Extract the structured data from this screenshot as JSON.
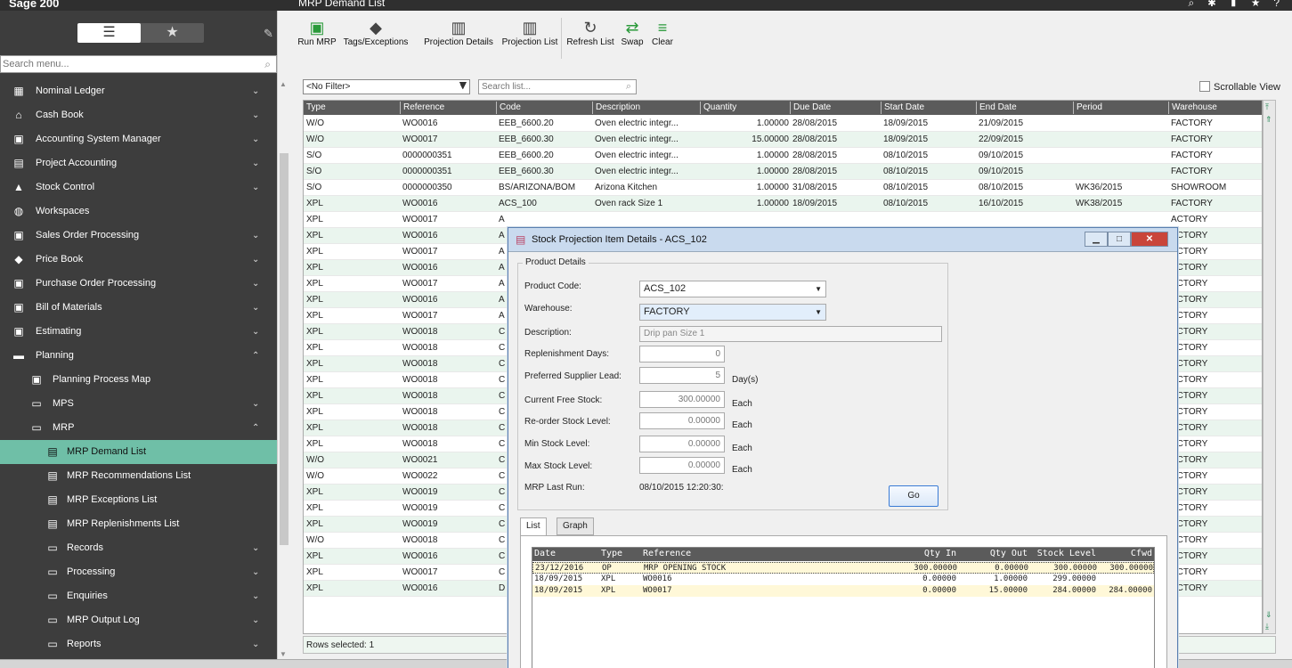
{
  "app": {
    "brand": "Sage 200",
    "page_title": "MRP Demand List"
  },
  "sidebar": {
    "search_placeholder": "Search menu...",
    "items": [
      {
        "label": "Nominal Ledger",
        "icon": "book-icon",
        "level": 0,
        "chevron": "down"
      },
      {
        "label": "Cash Book",
        "icon": "bank-icon",
        "level": 0,
        "chevron": "down"
      },
      {
        "label": "Accounting System Manager",
        "icon": "accounting-icon",
        "level": 0,
        "chevron": "down"
      },
      {
        "label": "Project Accounting",
        "icon": "clipboard-icon",
        "level": 0,
        "chevron": "down"
      },
      {
        "label": "Stock Control",
        "icon": "boxes-icon",
        "level": 0,
        "chevron": "down"
      },
      {
        "label": "Workspaces",
        "icon": "globe-icon",
        "level": 0,
        "chevron": ""
      },
      {
        "label": "Sales Order Processing",
        "icon": "sales-icon",
        "level": 0,
        "chevron": "down"
      },
      {
        "label": "Price Book",
        "icon": "pricebook-icon",
        "level": 0,
        "chevron": "down"
      },
      {
        "label": "Purchase Order Processing",
        "icon": "purchase-icon",
        "level": 0,
        "chevron": "down"
      },
      {
        "label": "Bill of Materials",
        "icon": "bom-icon",
        "level": 0,
        "chevron": "down"
      },
      {
        "label": "Estimating",
        "icon": "estimating-icon",
        "level": 0,
        "chevron": "down"
      },
      {
        "label": "Planning",
        "icon": "planning-icon",
        "level": 0,
        "chevron": "up"
      },
      {
        "label": "Planning Process Map",
        "icon": "process-map-icon",
        "level": 1,
        "chevron": ""
      },
      {
        "label": "MPS",
        "icon": "folder-icon",
        "level": 1,
        "chevron": "down"
      },
      {
        "label": "MRP",
        "icon": "folder-icon",
        "level": 1,
        "chevron": "up"
      },
      {
        "label": "MRP Demand List",
        "icon": "list-icon",
        "level": 2,
        "chevron": "",
        "active": true
      },
      {
        "label": "MRP Recommendations List",
        "icon": "list-icon",
        "level": 2,
        "chevron": ""
      },
      {
        "label": "MRP Exceptions List",
        "icon": "list-icon",
        "level": 2,
        "chevron": ""
      },
      {
        "label": "MRP Replenishments List",
        "icon": "list-icon",
        "level": 2,
        "chevron": ""
      },
      {
        "label": "Records",
        "icon": "folder-icon",
        "level": 2,
        "chevron": "down"
      },
      {
        "label": "Processing",
        "icon": "folder-icon",
        "level": 2,
        "chevron": "down"
      },
      {
        "label": "Enquiries",
        "icon": "folder-icon",
        "level": 2,
        "chevron": "down"
      },
      {
        "label": "MRP Output Log",
        "icon": "folder-icon",
        "level": 2,
        "chevron": "down"
      },
      {
        "label": "Reports",
        "icon": "folder-icon",
        "level": 2,
        "chevron": "down"
      }
    ]
  },
  "toolbar": {
    "buttons": [
      {
        "label": "Run MRP",
        "icon": "run-mrp-icon"
      },
      {
        "label": "Tags/Exceptions",
        "icon": "tag-icon"
      },
      {
        "label": "Projection Details",
        "icon": "projection-details-icon"
      },
      {
        "label": "Projection List",
        "icon": "projection-list-icon"
      },
      {
        "label": "Refresh List",
        "icon": "refresh-icon"
      },
      {
        "label": "Swap",
        "icon": "swap-icon"
      },
      {
        "label": "Clear",
        "icon": "clear-icon"
      }
    ]
  },
  "filter": {
    "selected": "<No Filter>",
    "search_placeholder": "Search list...",
    "scrollable_view_label": "Scrollable View"
  },
  "grid": {
    "columns": [
      "Type",
      "Reference",
      "Code",
      "Description",
      "Quantity",
      "Due Date",
      "Start Date",
      "End Date",
      "Period",
      "Warehouse"
    ],
    "rows": [
      [
        "W/O",
        "WO0016",
        "EEB_6600.20",
        "Oven electric integr...",
        "1.00000",
        "28/08/2015",
        "18/09/2015",
        "21/09/2015",
        "",
        "FACTORY"
      ],
      [
        "W/O",
        "WO0017",
        "EEB_6600.30",
        "Oven electric integr...",
        "15.00000",
        "28/08/2015",
        "18/09/2015",
        "22/09/2015",
        "",
        "FACTORY"
      ],
      [
        "S/O",
        "0000000351",
        "EEB_6600.20",
        "Oven electric integr...",
        "1.00000",
        "28/08/2015",
        "08/10/2015",
        "09/10/2015",
        "",
        "FACTORY"
      ],
      [
        "S/O",
        "0000000351",
        "EEB_6600.30",
        "Oven electric integr...",
        "1.00000",
        "28/08/2015",
        "08/10/2015",
        "09/10/2015",
        "",
        "FACTORY"
      ],
      [
        "S/O",
        "0000000350",
        "BS/ARIZONA/BOM",
        "Arizona Kitchen",
        "1.00000",
        "31/08/2015",
        "08/10/2015",
        "08/10/2015",
        "WK36/2015",
        "SHOWROOM"
      ],
      [
        "XPL",
        "WO0016",
        "ACS_100",
        "Oven rack Size 1",
        "1.00000",
        "18/09/2015",
        "08/10/2015",
        "16/10/2015",
        "WK38/2015",
        "FACTORY"
      ],
      [
        "XPL",
        "WO0017",
        "A",
        "",
        "",
        "",
        "",
        "",
        "",
        "ACTORY"
      ],
      [
        "XPL",
        "WO0016",
        "A",
        "",
        "",
        "",
        "",
        "",
        "",
        "ACTORY"
      ],
      [
        "XPL",
        "WO0017",
        "A",
        "",
        "",
        "",
        "",
        "",
        "",
        "ACTORY"
      ],
      [
        "XPL",
        "WO0016",
        "A",
        "",
        "",
        "",
        "",
        "",
        "",
        "ACTORY"
      ],
      [
        "XPL",
        "WO0017",
        "A",
        "",
        "",
        "",
        "",
        "",
        "",
        "ACTORY"
      ],
      [
        "XPL",
        "WO0016",
        "A",
        "",
        "",
        "",
        "",
        "",
        "",
        "ACTORY"
      ],
      [
        "XPL",
        "WO0017",
        "A",
        "",
        "",
        "",
        "",
        "",
        "",
        "ACTORY"
      ],
      [
        "XPL",
        "WO0018",
        "C",
        "",
        "",
        "",
        "",
        "",
        "",
        "ACTORY"
      ],
      [
        "XPL",
        "WO0018",
        "C",
        "",
        "",
        "",
        "",
        "",
        "",
        "ACTORY"
      ],
      [
        "XPL",
        "WO0018",
        "C",
        "",
        "",
        "",
        "",
        "",
        "",
        "ACTORY"
      ],
      [
        "XPL",
        "WO0018",
        "C",
        "",
        "",
        "",
        "",
        "",
        "",
        "ACTORY"
      ],
      [
        "XPL",
        "WO0018",
        "C",
        "",
        "",
        "",
        "",
        "",
        "",
        "ACTORY"
      ],
      [
        "XPL",
        "WO0018",
        "C",
        "",
        "",
        "",
        "",
        "",
        "",
        "ACTORY"
      ],
      [
        "XPL",
        "WO0018",
        "C",
        "",
        "",
        "",
        "",
        "",
        "",
        "ACTORY"
      ],
      [
        "XPL",
        "WO0018",
        "C",
        "",
        "",
        "",
        "",
        "",
        "",
        "ACTORY"
      ],
      [
        "W/O",
        "WO0021",
        "C",
        "",
        "",
        "",
        "",
        "",
        "",
        "ACTORY"
      ],
      [
        "W/O",
        "WO0022",
        "C",
        "",
        "",
        "",
        "",
        "",
        "",
        "ACTORY"
      ],
      [
        "XPL",
        "WO0019",
        "C",
        "",
        "",
        "",
        "",
        "",
        "",
        "ACTORY"
      ],
      [
        "XPL",
        "WO0019",
        "C",
        "",
        "",
        "",
        "",
        "",
        "",
        "ACTORY"
      ],
      [
        "XPL",
        "WO0019",
        "C",
        "",
        "",
        "",
        "",
        "",
        "",
        "ACTORY"
      ],
      [
        "W/O",
        "WO0018",
        "C",
        "",
        "",
        "",
        "",
        "",
        "",
        "ACTORY"
      ],
      [
        "XPL",
        "WO0016",
        "C",
        "",
        "",
        "",
        "",
        "",
        "",
        "ACTORY"
      ],
      [
        "XPL",
        "WO0017",
        "C",
        "",
        "",
        "",
        "",
        "",
        "",
        "ACTORY"
      ],
      [
        "XPL",
        "WO0016",
        "D",
        "",
        "",
        "",
        "",
        "",
        "",
        "ACTORY"
      ]
    ],
    "status": "Rows selected: 1"
  },
  "dialog": {
    "title": "Stock Projection Item Details - ACS_102",
    "group_label": "Product Details",
    "product_code_label": "Product Code:",
    "product_code": "ACS_102",
    "warehouse_label": "Warehouse:",
    "warehouse": "FACTORY",
    "description_label": "Description:",
    "description": "Drip pan Size 1",
    "replenishment_label": "Replenishment Days:",
    "replenishment": "0",
    "supplier_lead_label": "Preferred Supplier Lead:",
    "supplier_lead": "5",
    "supplier_lead_unit": "Day(s)",
    "free_stock_label": "Current Free Stock:",
    "free_stock": "300.00000",
    "reorder_label": "Re-order Stock Level:",
    "reorder": "0.00000",
    "min_label": "Min Stock Level:",
    "min": "0.00000",
    "max_label": "Max Stock Level:",
    "max": "0.00000",
    "unit_each": "Each",
    "last_run_label": "MRP Last Run:",
    "last_run": "08/10/2015 12:20:30:",
    "go_label": "Go",
    "tabs": [
      "List",
      "Graph"
    ],
    "inner_columns": [
      "Date",
      "Type",
      "Reference",
      "Qty In",
      "Qty Out",
      "Stock Level",
      "Cfwd"
    ],
    "inner_rows": [
      [
        "23/12/2016",
        "OP",
        "MRP OPENING STOCK",
        "300.00000",
        "0.00000",
        "300.00000",
        "300.00000"
      ],
      [
        "18/09/2015",
        "XPL",
        "WO0016",
        "0.00000",
        "1.00000",
        "299.00000",
        ""
      ],
      [
        "18/09/2015",
        "XPL",
        "WO0017",
        "0.00000",
        "15.00000",
        "284.00000",
        "284.00000"
      ]
    ]
  }
}
